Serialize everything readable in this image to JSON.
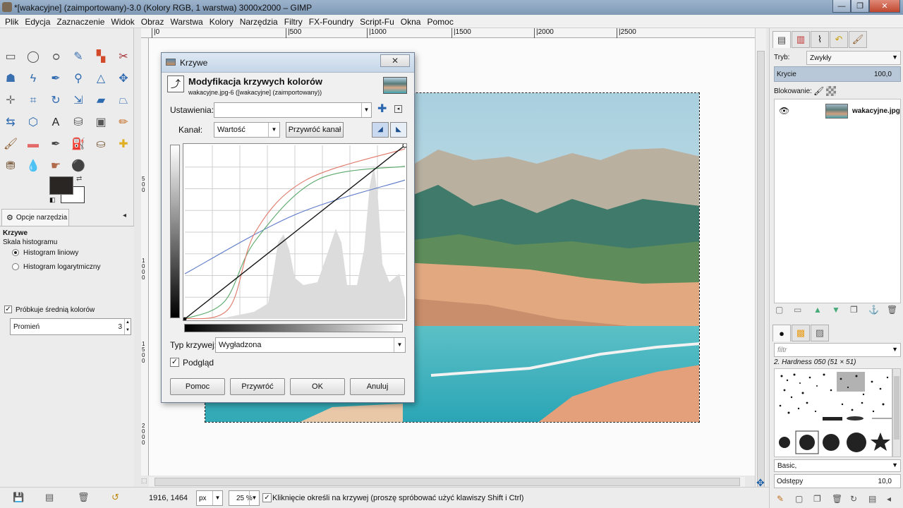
{
  "window": {
    "title": "*[wakacyjne] (zaimportowany)-3.0 (Kolory RGB, 1 warstwa) 3000x2000 – GIMP",
    "min_glyph": "—",
    "max_glyph": "❐",
    "close_glyph": "✕"
  },
  "menu": [
    "Plik",
    "Edycja",
    "Zaznaczenie",
    "Widok",
    "Obraz",
    "Warstwa",
    "Kolory",
    "Narzędzia",
    "Filtry",
    "FX-Foundry",
    "Script-Fu",
    "Okna",
    "Pomoc"
  ],
  "rulers": {
    "top_ticks": [
      "|500",
      "|1000",
      "|1500",
      "|2000",
      "|2500"
    ],
    "left_ticks": [
      "5\n0\n0",
      "1\n0\n0\n0",
      "1\n5\n0\n0",
      "2\n0\n0\n0"
    ]
  },
  "toolbox": {
    "tool_icons": [
      {
        "name": "rect-select-icon",
        "glyph": "▭",
        "color": "#555555"
      },
      {
        "name": "ellipse-select-icon",
        "glyph": "◯",
        "color": "#555555"
      },
      {
        "name": "free-select-icon",
        "glyph": "ഠ",
        "color": "#555555"
      },
      {
        "name": "fuzzy-select-icon",
        "glyph": "✎",
        "color": "#3a6fb0"
      },
      {
        "name": "color-select-icon",
        "glyph": "▚",
        "color": "#d24a2a"
      },
      {
        "name": "scissors-select-icon",
        "glyph": "✂",
        "color": "#a33030"
      },
      {
        "name": "foreground-select-icon",
        "glyph": "☗",
        "color": "#3a6fb0"
      },
      {
        "name": "paths-icon",
        "glyph": "ϟ",
        "color": "#2e6ab0"
      },
      {
        "name": "color-picker-icon",
        "glyph": "✒",
        "color": "#2e6ab0"
      },
      {
        "name": "zoom-icon",
        "glyph": "⚲",
        "color": "#2e6ab0"
      },
      {
        "name": "measure-icon",
        "glyph": "△",
        "color": "#2e6ab0"
      },
      {
        "name": "move-icon",
        "glyph": "✥",
        "color": "#2e6ab0"
      },
      {
        "name": "align-icon",
        "glyph": "✛",
        "color": "#777777"
      },
      {
        "name": "crop-icon",
        "glyph": "⌗",
        "color": "#2e6ab0"
      },
      {
        "name": "rotate-icon",
        "glyph": "↻",
        "color": "#2e6ab0"
      },
      {
        "name": "scale-icon",
        "glyph": "⇲",
        "color": "#2e6ab0"
      },
      {
        "name": "shear-icon",
        "glyph": "▰",
        "color": "#2e6ab0"
      },
      {
        "name": "perspective-icon",
        "glyph": "⏢",
        "color": "#2e6ab0"
      },
      {
        "name": "flip-icon",
        "glyph": "⇆",
        "color": "#2e6ab0"
      },
      {
        "name": "cage-transform-icon",
        "glyph": "⬡",
        "color": "#2e6ab0"
      },
      {
        "name": "text-icon",
        "glyph": "A",
        "color": "#222222"
      },
      {
        "name": "bucket-fill-icon",
        "glyph": "⛁",
        "color": "#555555"
      },
      {
        "name": "blend-icon",
        "glyph": "▣",
        "color": "#555555"
      },
      {
        "name": "pencil-icon",
        "glyph": "✏",
        "color": "#c46a1e"
      },
      {
        "name": "paintbrush-icon",
        "glyph": "🖌",
        "color": "#8a5a2a"
      },
      {
        "name": "eraser-icon",
        "glyph": "▬",
        "color": "#e46a6a"
      },
      {
        "name": "airbrush-icon",
        "glyph": "✒",
        "color": "#444444"
      },
      {
        "name": "ink-icon",
        "glyph": "⛽",
        "color": "#2e4a7a"
      },
      {
        "name": "clone-icon",
        "glyph": "⛀",
        "color": "#7a5a3a"
      },
      {
        "name": "heal-icon",
        "glyph": "✚",
        "color": "#e0b020"
      },
      {
        "name": "perspective-clone-icon",
        "glyph": "⛃",
        "color": "#7a5a3a"
      },
      {
        "name": "blur-icon",
        "glyph": "💧",
        "color": "#2e6ab0"
      },
      {
        "name": "smudge-icon",
        "glyph": "☛",
        "color": "#b06a4a"
      },
      {
        "name": "dodge-burn-icon",
        "glyph": "⚫",
        "color": "#333333"
      }
    ],
    "fg_color": "#2a2624",
    "bg_color": "#ffffff",
    "tool_options_tab": "Opcje narzędzia",
    "options": {
      "heading": "Krzywe",
      "histogram_scale": "Skala histogramu",
      "linear": "Histogram liniowy",
      "logarithmic": "Histogram logarytmiczny",
      "sample_average": "Próbkuje średnią kolorów",
      "radius_label": "Promień",
      "radius_value": "3"
    }
  },
  "status": {
    "coords": "1916, 1464",
    "unit": "px",
    "zoom": "25 %",
    "message": "Kliknięcie określi na krzywej (proszę spróbować użyć klawiszy Shift i Ctrl)"
  },
  "dock": {
    "mode_label": "Tryb:",
    "mode_value": "Zwykły",
    "opacity_label": "Krycie",
    "opacity_value": "100,0",
    "lock_label": "Blokowanie:",
    "layer_name": "wakacyjne.jpg",
    "filter_placeholder": "filtr",
    "brush_name": "2. Hardness 050 (51 × 51)",
    "brush_tag": "Basic,",
    "spacing_label": "Odstępy",
    "spacing_value": "10,0"
  },
  "dialog": {
    "title": "Krzywe",
    "header": "Modyfikacja krzywych kolorów",
    "subheader": "wakacyjne.jpg-6 ([wakacyjne] (zaimportowany))",
    "presets_label": "Ustawienia:",
    "channel_label": "Kanał:",
    "channel_value": "Wartość",
    "reset_channel": "Przywróć kanał",
    "curve_type_label": "Typ krzywej:",
    "curve_type_value": "Wygładzona",
    "preview_label": "Podgląd",
    "buttons": {
      "help": "Pomoc",
      "reset": "Przywróć",
      "ok": "OK",
      "cancel": "Anuluj"
    },
    "curves": {
      "value": [
        [
          0,
          0
        ],
        [
          1,
          1
        ]
      ],
      "red": [
        [
          0,
          0
        ],
        [
          0.2,
          0.06
        ],
        [
          0.32,
          0.5
        ],
        [
          0.55,
          0.8
        ],
        [
          1,
          0.98
        ]
      ],
      "green": [
        [
          0,
          0
        ],
        [
          0.18,
          0.1
        ],
        [
          0.32,
          0.45
        ],
        [
          0.6,
          0.8
        ],
        [
          1,
          0.88
        ]
      ],
      "blue": [
        [
          0,
          0.26
        ],
        [
          0.5,
          0.6
        ],
        [
          1,
          0.8
        ]
      ]
    },
    "curve_colors": {
      "value": "#111111",
      "red": "#e0786a",
      "green": "#5aa86a",
      "blue": "#5a78c8"
    }
  }
}
